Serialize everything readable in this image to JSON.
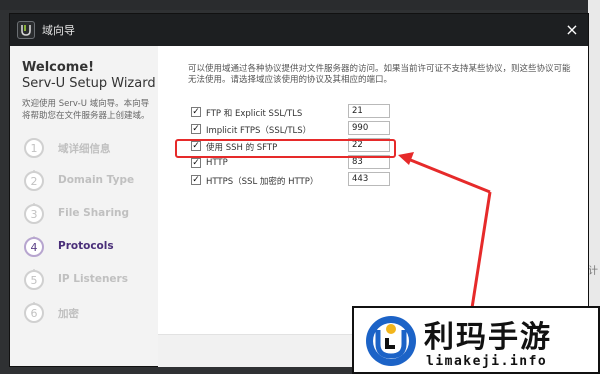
{
  "window": {
    "title": "域向导",
    "close": "×"
  },
  "sidebar": {
    "welcome": "Welcome!",
    "wizard": "Serv-U Setup Wizard",
    "description": "欢迎使用 Serv-U 域向导。本向导将帮助您在文件服务器上创建域。",
    "steps": [
      {
        "num": "1",
        "label": "域详细信息",
        "active": false
      },
      {
        "num": "2",
        "label": "Domain Type",
        "active": false
      },
      {
        "num": "3",
        "label": "File Sharing",
        "active": false
      },
      {
        "num": "4",
        "label": "Protocols",
        "active": true
      },
      {
        "num": "5",
        "label": "IP Listeners",
        "active": false
      },
      {
        "num": "6",
        "label": "加密",
        "active": false
      }
    ]
  },
  "content": {
    "intro": "可以使用域通过各种协议提供对文件服务器的访问。如果当前许可证不支持某些协议，则这些协议可能无法使用。请选择域应该使用的协议及其相应的端口。",
    "protocols": [
      {
        "label": "FTP 和 Explicit SSL/TLS",
        "port": "21",
        "checked": true
      },
      {
        "label": "Implicit FTPS（SSL/TLS）",
        "port": "990",
        "checked": true
      },
      {
        "label": "使用 SSH 的 SFTP",
        "port": "22",
        "checked": true
      },
      {
        "label": "HTTP",
        "port": "83",
        "checked": true
      },
      {
        "label": "HTTPS（SSL 加密的 HTTP）",
        "port": "443",
        "checked": true
      }
    ]
  },
  "background": {
    "partial_text": "计"
  },
  "watermark": {
    "name_cn": "利玛手游",
    "url": "limakeji.info"
  },
  "colors": {
    "titlebar": "#1d1f21",
    "active_step": "#4a2f79",
    "annotation": "#e62a2a"
  }
}
